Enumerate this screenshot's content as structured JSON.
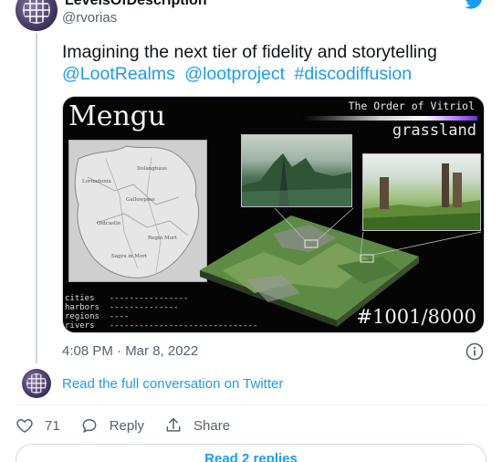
{
  "author": {
    "display_name": "LevelsOfDescription",
    "handle": "@rvorias"
  },
  "tweet": {
    "text": "Imagining the next tier of fidelity and storytelling",
    "links": [
      "@LootRealms",
      "@lootproject",
      "#discodiffusion"
    ]
  },
  "media": {
    "title": "Mengu",
    "subtitle": "The Order of Vitriol",
    "biome": "grassland",
    "counter": "#1001/8000",
    "map_labels": [
      "Lornadonia",
      "Dolanghaus",
      "Gallowpass",
      "Oldcastle",
      "Regin Mort",
      "Sagra in Mort"
    ],
    "legend": [
      {
        "label": "cities",
        "line": "----------------"
      },
      {
        "label": "harbors",
        "line": "--------------"
      },
      {
        "label": "regions",
        "line": "----"
      },
      {
        "label": "rivers",
        "line": "------------------------------"
      }
    ]
  },
  "meta": {
    "timestamp": "4:08 PM · Mar 8, 2022"
  },
  "conversation": {
    "link_text": "Read the full conversation on Twitter"
  },
  "actions": {
    "like_count": "71",
    "reply_label": "Reply",
    "share_label": "Share"
  },
  "replies": {
    "label": "Read 2 replies"
  },
  "colors": {
    "accent": "#1d9bf0",
    "muted_text": "#536471",
    "border": "#cfd9de"
  }
}
